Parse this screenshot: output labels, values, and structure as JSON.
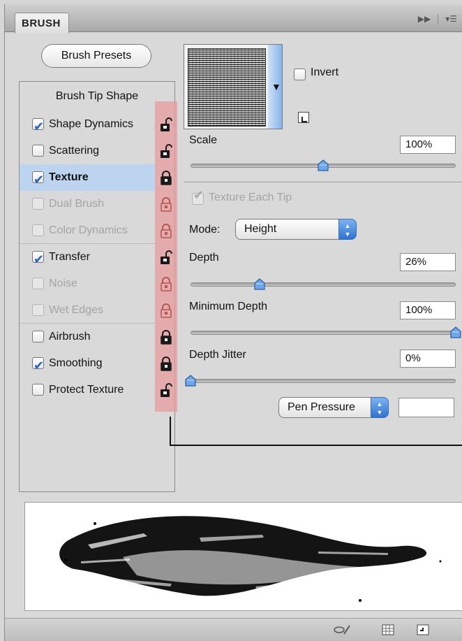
{
  "panel": {
    "tab_label": "BRUSH",
    "presets_button": "Brush Presets"
  },
  "sidebar": {
    "title": "Brush Tip Shape",
    "items": [
      {
        "label": "Shape Dynamics",
        "checked": true,
        "enabled": true,
        "locked": false
      },
      {
        "label": "Scattering",
        "checked": false,
        "enabled": true,
        "locked": false
      },
      {
        "label": "Texture",
        "checked": true,
        "enabled": true,
        "locked": true,
        "selected": true
      },
      {
        "label": "Dual Brush",
        "checked": false,
        "enabled": false,
        "locked": true
      },
      {
        "label": "Color Dynamics",
        "checked": false,
        "enabled": false,
        "locked": true
      },
      {
        "label": "Transfer",
        "checked": true,
        "enabled": true,
        "locked": false
      },
      {
        "label": "Noise",
        "checked": false,
        "enabled": false,
        "locked": true
      },
      {
        "label": "Wet Edges",
        "checked": false,
        "enabled": false,
        "locked": true
      },
      {
        "label": "Airbrush",
        "checked": false,
        "enabled": true,
        "locked": true
      },
      {
        "label": "Smoothing",
        "checked": true,
        "enabled": true,
        "locked": true
      },
      {
        "label": "Protect Texture",
        "checked": false,
        "enabled": true,
        "locked": false
      }
    ]
  },
  "texture": {
    "invert_label": "Invert",
    "invert_checked": false,
    "scale_label": "Scale",
    "scale_value": "100%",
    "scale_level": 0.5,
    "texture_each_tip_label": "Texture Each Tip",
    "texture_each_tip_checked": true,
    "mode_label": "Mode:",
    "mode_value": "Height",
    "depth_label": "Depth",
    "depth_value": "26%",
    "depth_level": 0.26,
    "min_depth_label": "Minimum Depth",
    "min_depth_value": "100%",
    "min_depth_level": 1.0,
    "depth_jitter_label": "Depth Jitter",
    "depth_jitter_value": "0%",
    "depth_jitter_level": 0.0,
    "control_value": "Pen Pressure",
    "control_extra_value": ""
  },
  "colors": {
    "selected_row": "#bcd4ef",
    "lock_highlight": "#e69b9b",
    "checkbox_check": "#2a63b7",
    "select_accent": "#2f74d0"
  }
}
